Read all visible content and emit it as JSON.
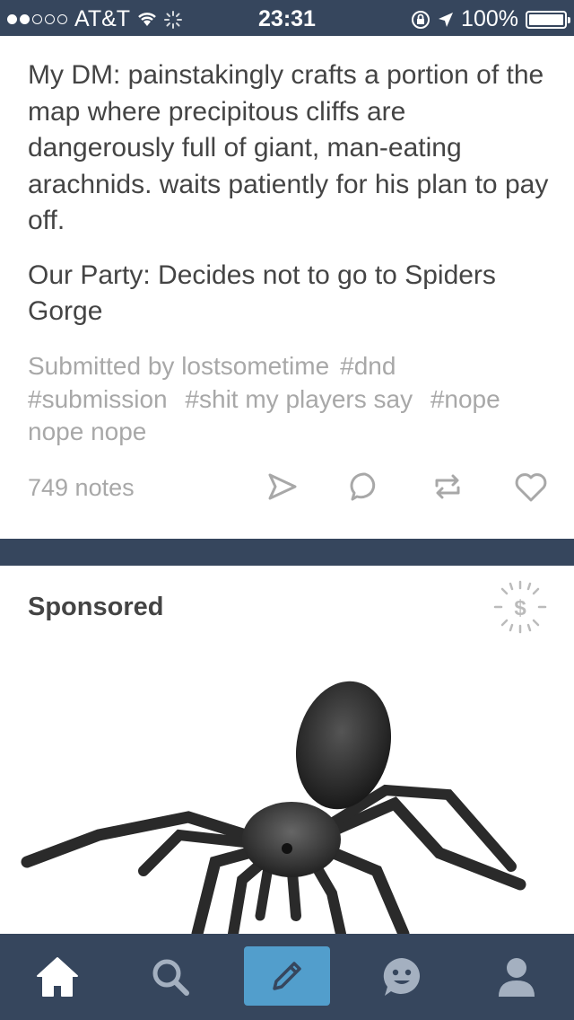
{
  "status_bar": {
    "carrier": "AT&T",
    "time": "23:31",
    "battery": "100%",
    "signal_bars_filled": 2,
    "signal_bars_total": 5
  },
  "post": {
    "paragraphs": [
      "My DM: painstakingly crafts a portion of the map where precipitous cliffs are dangerously full of giant, man-eating arachnids. waits patiently for his plan to pay off.",
      "Our Party: Decides not to go to Spiders Gorge"
    ],
    "tags": {
      "line1": "Submitted by lostsometime",
      "tag_dnd": "#dnd",
      "tag_submission": "#submission",
      "tag_shit": "#shit my players say",
      "tag_nope": "#nope",
      "tag_nope2": "nope nope"
    },
    "notes": "749 notes",
    "actions": [
      "share-icon",
      "reply-icon",
      "reblog-icon",
      "like-icon"
    ]
  },
  "sponsored": {
    "label": "Sponsored",
    "icon": "dollar-icon",
    "image": "spider-image"
  },
  "tab_bar": {
    "tabs": [
      "home-icon",
      "search-icon",
      "compose-icon",
      "activity-icon",
      "account-icon"
    ]
  },
  "colors": {
    "navy": "#36465d",
    "accent": "#529ecc",
    "text": "#444444",
    "muted": "#a8a8a8"
  }
}
